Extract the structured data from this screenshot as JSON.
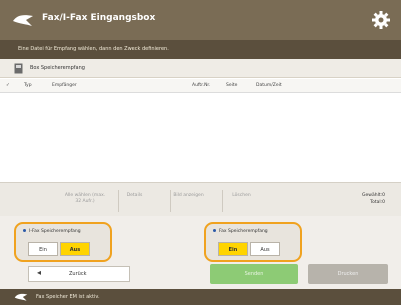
{
  "header": {
    "title": "Fax/I-Fax Eingangsbox"
  },
  "instruction": "Eine Datei für Empfang wählen, dann den Zweck definieren.",
  "box": {
    "label": "Box Speicherempfang"
  },
  "columns": {
    "typ": "Typ",
    "empfaenger": "Empfänger",
    "auftr": "Auftr.Nr.",
    "seite": "Seite",
    "datum": "Datum/Zeit"
  },
  "toolbar": {
    "select_all": "Alle wählen (max. 32 Aufr.)",
    "details": "Details",
    "bild": "Bild anzeigen",
    "loeschen": "Löschen",
    "selected_label": "Gewählt:0",
    "total_label": "Total:0"
  },
  "ifax_group": {
    "title": "I-Fax Speicherempfang",
    "ein": "Ein",
    "aus": "Aus",
    "selected": "aus"
  },
  "fax_group": {
    "title": "Fax Speicherempfang",
    "ein": "Ein",
    "aus": "Aus",
    "selected": "ein"
  },
  "buttons": {
    "back": "Zurück",
    "send": "Senden",
    "print": "Drucken"
  },
  "status": {
    "text": "Fax Speicher EM ist aktiv."
  },
  "colors": {
    "titlebar": "#7a6c55",
    "highlight_ring": "#f0a21f",
    "selected_segment": "#ffd400",
    "send_green": "#7cc561"
  },
  "icons": {
    "logo": "fax-bird-icon",
    "settings": "gear-icon",
    "box": "inbox-icon",
    "back": "back-arrow-icon",
    "check": "checkmark-icon"
  }
}
